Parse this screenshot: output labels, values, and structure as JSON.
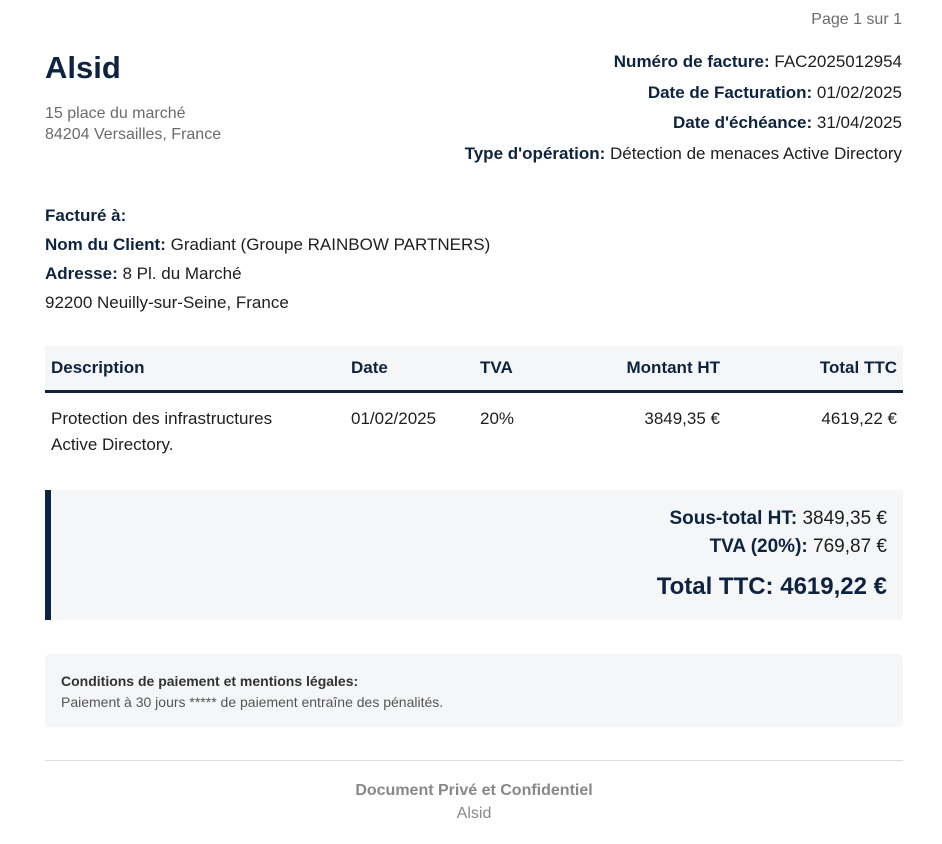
{
  "page_indicator": "Page 1 sur 1",
  "company": {
    "name": "Alsid",
    "address_line1": "15 place du marché",
    "address_line2": "84204 Versailles, France"
  },
  "invoice_meta": {
    "number_label": "Numéro de facture:",
    "number_value": "FAC2025012954",
    "billing_date_label": "Date de Facturation:",
    "billing_date_value": "01/02/2025",
    "due_date_label": "Date d'échéance:",
    "due_date_value": "31/04/2025",
    "operation_type_label": "Type d'opération:",
    "operation_type_value": "Détection de menaces Active Directory"
  },
  "bill_to": {
    "heading": "Facturé à:",
    "client_label": "Nom du Client:",
    "client_value": "Gradiant (Groupe RAINBOW PARTNERS)",
    "address_label": "Adresse:",
    "address_value": "8 Pl. du Marché",
    "address_line2": "92200 Neuilly-sur-Seine, France"
  },
  "items_table": {
    "headers": [
      "Description",
      "Date",
      "TVA",
      "Montant HT",
      "Total TTC"
    ],
    "rows": [
      {
        "description_line1": "Protection des infrastructures",
        "description_line2": "Active Directory.",
        "date": "01/02/2025",
        "tva": "20%",
        "amount_ht": "3849,35 €",
        "total_ttc": "4619,22 €"
      }
    ]
  },
  "totals": {
    "subtotal_label": "Sous-total HT:",
    "subtotal_value": "3849,35 €",
    "tva_label": "TVA (20%):",
    "tva_value": "769,87 €",
    "total_label": "Total TTC:",
    "total_value": "4619,22 €"
  },
  "conditions": {
    "title": "Conditions de paiement et mentions légales:",
    "text": "Paiement à 30 jours ***** de paiement entraîne des pénalités."
  },
  "footer": {
    "title": "Document Privé et Confidentiel",
    "company": "Alsid"
  },
  "colors": {
    "accent_navy": "#0e2340",
    "panel_background": "#f4f6f8",
    "muted_text": "#6b6b6b"
  }
}
